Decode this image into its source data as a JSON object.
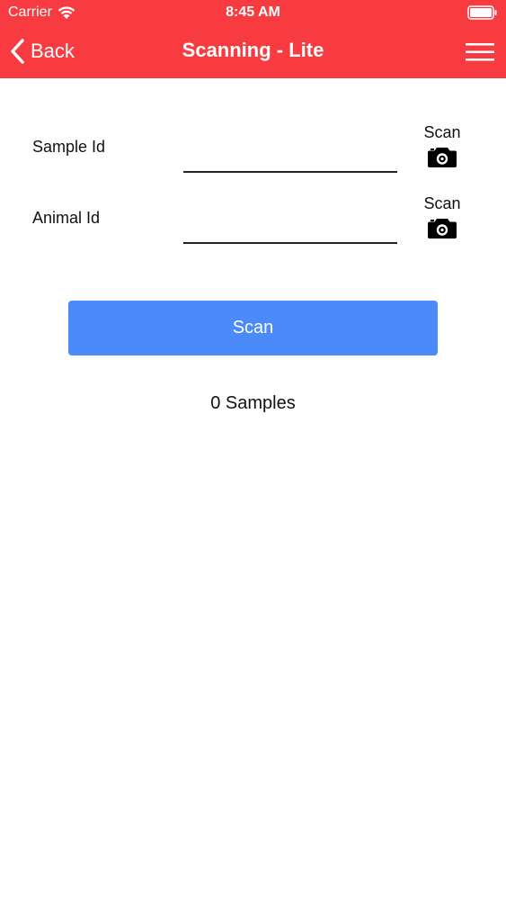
{
  "status_bar": {
    "carrier": "Carrier",
    "time": "8:45 AM"
  },
  "nav": {
    "back_label": "Back",
    "title": "Scanning - Lite"
  },
  "fields": [
    {
      "label": "Sample Id",
      "value": "",
      "scan_label": "Scan"
    },
    {
      "label": "Animal Id",
      "value": "",
      "scan_label": "Scan"
    }
  ],
  "scan_button": {
    "label": "Scan"
  },
  "samples_summary": "0 Samples",
  "icons": {
    "wifi": "wifi-icon",
    "battery": "battery-icon",
    "back": "chevron-left-icon",
    "menu": "hamburger-menu-icon",
    "camera": "camera-icon"
  },
  "colors": {
    "header": "#f73b40",
    "primary_button": "#4a8af9",
    "background": "#fefefe"
  }
}
